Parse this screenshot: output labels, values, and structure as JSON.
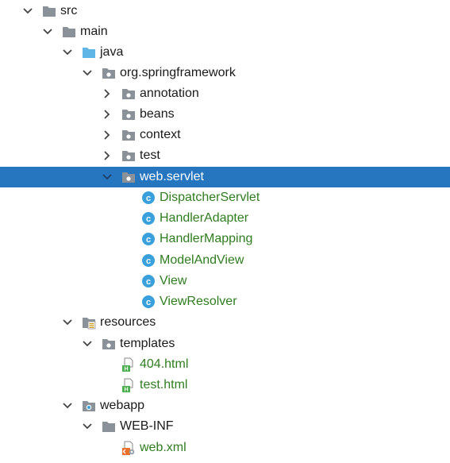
{
  "tree": {
    "src": "src",
    "main": "main",
    "java": "java",
    "org_springframework": "org.springframework",
    "annotation": "annotation",
    "beans": "beans",
    "context": "context",
    "test": "test",
    "web_servlet": "web.servlet",
    "classes": [
      "DispatcherServlet",
      "HandlerAdapter",
      "HandlerMapping",
      "ModelAndView",
      "View",
      "ViewResolver"
    ],
    "resources": "resources",
    "templates": "templates",
    "html_files": [
      "404.html",
      "test.html"
    ],
    "webapp": "webapp",
    "web_inf": "WEB-INF",
    "web_xml": "web.xml"
  },
  "colors": {
    "selection": "#2675bf",
    "file_green": "#2f7d1f",
    "folder_gray": "#8a9199",
    "folder_blue": "#5fb6e6",
    "class_icon": "#3aa0dc"
  }
}
